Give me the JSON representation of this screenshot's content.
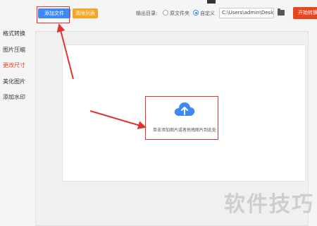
{
  "toolbar": {
    "add_files": "添加文件",
    "clear_list": "清除列表",
    "output_label": "输出目录:",
    "option_original": "原文件夹",
    "option_custom": "自定义",
    "path_value": "C:\\Users\\admin\\Deskto",
    "start": "开始转换"
  },
  "sidebar": {
    "items": [
      {
        "label": "格式转换"
      },
      {
        "label": "图片压缩"
      },
      {
        "label": "更改尺寸"
      },
      {
        "label": "美化图片"
      },
      {
        "label": "添加水印"
      }
    ]
  },
  "drop_area": {
    "hint": "单击添加图片或者拖拽图片到此处"
  },
  "watermark": "软件技巧",
  "colors": {
    "primary": "#3d8af7",
    "clear": "#f5a623",
    "start": "#e8461f",
    "annotation": "#e03434"
  },
  "icons": [
    "upload-cloud-icon",
    "folder-icon"
  ]
}
